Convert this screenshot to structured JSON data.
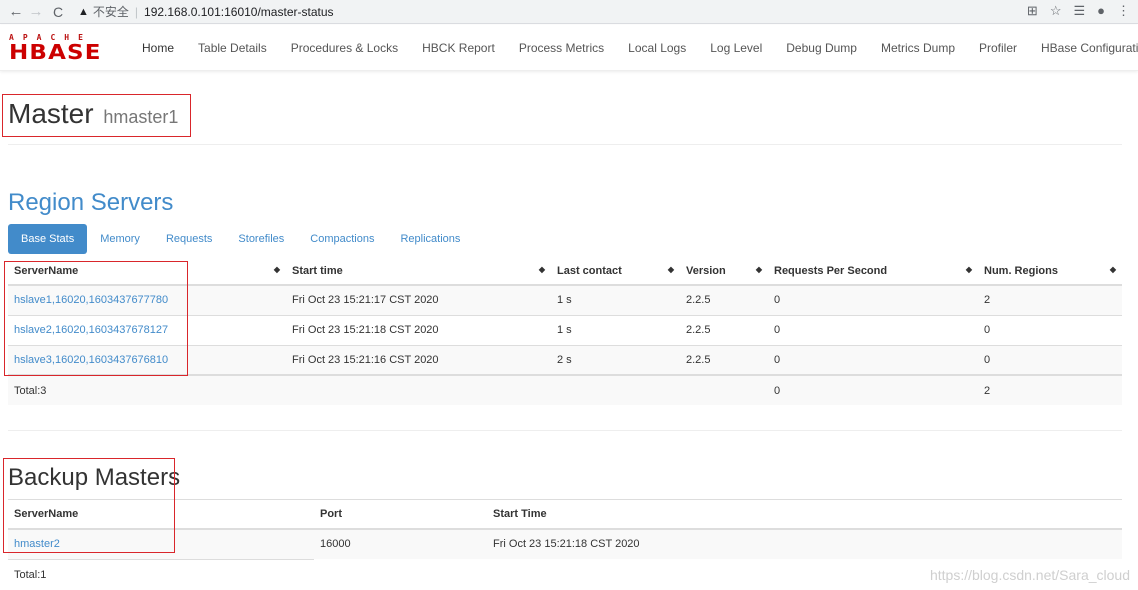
{
  "browser": {
    "back_icon": "arrow-left-icon",
    "forward_icon": "arrow-right-icon",
    "reload_icon": "reload-icon",
    "security_label": "不安全",
    "url": "192.168.0.101:16010/master-status",
    "right_icons": [
      "translate-icon",
      "star-icon",
      "reading-list-icon",
      "account-icon",
      "menu-icon"
    ]
  },
  "logo": {
    "top": "APACHE",
    "main": "HBASE"
  },
  "nav": {
    "items": [
      {
        "label": "Home"
      },
      {
        "label": "Table Details"
      },
      {
        "label": "Procedures & Locks"
      },
      {
        "label": "HBCK Report"
      },
      {
        "label": "Process Metrics"
      },
      {
        "label": "Local Logs"
      },
      {
        "label": "Log Level"
      },
      {
        "label": "Debug Dump"
      },
      {
        "label": "Metrics Dump"
      },
      {
        "label": "Profiler"
      },
      {
        "label": "HBase Configuration"
      }
    ]
  },
  "master": {
    "title": "Master",
    "hostname": "hmaster1"
  },
  "region_servers": {
    "heading": "Region Servers",
    "tabs": [
      "Base Stats",
      "Memory",
      "Requests",
      "Storefiles",
      "Compactions",
      "Replications"
    ],
    "columns": [
      "ServerName",
      "Start time",
      "Last contact",
      "Version",
      "Requests Per Second",
      "Num. Regions"
    ],
    "rows": [
      [
        "hslave1,16020,1603437677780",
        "Fri Oct 23 15:21:17 CST 2020",
        "1 s",
        "2.2.5",
        "0",
        "2"
      ],
      [
        "hslave2,16020,1603437678127",
        "Fri Oct 23 15:21:18 CST 2020",
        "1 s",
        "2.2.5",
        "0",
        "0"
      ],
      [
        "hslave3,16020,1603437676810",
        "Fri Oct 23 15:21:16 CST 2020",
        "2 s",
        "2.2.5",
        "0",
        "0"
      ]
    ],
    "total": [
      "Total:3",
      "",
      "",
      "",
      "0",
      "2"
    ]
  },
  "backup_masters": {
    "heading": "Backup Masters",
    "columns": [
      "ServerName",
      "Port",
      "Start Time"
    ],
    "rows": [
      [
        "hmaster2",
        "16000",
        "Fri Oct 23 15:21:18 CST 2020"
      ]
    ],
    "total": "Total:1"
  },
  "watermark": "https://blog.csdn.net/Sara_cloud",
  "colors": {
    "accent": "#428bca",
    "annotation": "#d9262b",
    "logo": "#cc0000"
  }
}
